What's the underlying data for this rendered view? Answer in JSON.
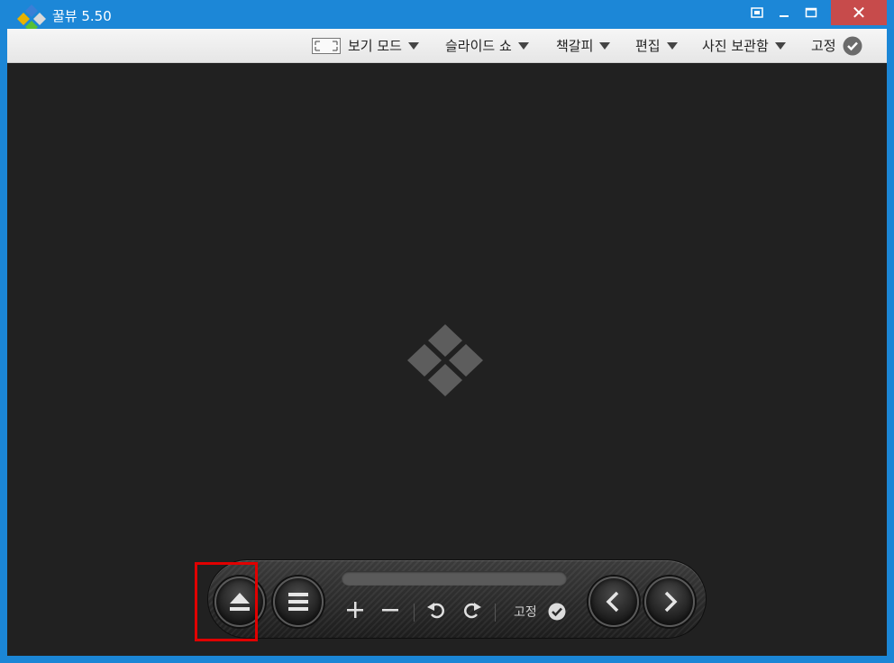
{
  "window": {
    "title": "꿀뷰 5.50",
    "close_symbol": "✕"
  },
  "menu": {
    "view_mode": "보기 모드",
    "slideshow": "슬라이드 쇼",
    "bookmark": "책갈피",
    "edit": "편집",
    "album": "사진 보관함",
    "pin": "고정"
  },
  "toolbar": {
    "pin_label": "고정",
    "progress": 0
  },
  "icons": {
    "app": "honeyview-diamond-logo",
    "view_mode": "fullscreen-frame-icon",
    "eject": "eject-icon",
    "menu": "hamburger-icon",
    "zoom_in": "plus-icon",
    "zoom_out": "minus-icon",
    "rotate_left": "rotate-left-icon",
    "rotate_right": "rotate-right-icon",
    "prev": "chevron-left-icon",
    "next": "chevron-right-icon",
    "check": "check-circle-icon"
  },
  "colors": {
    "titlebar": "#1c87d7",
    "close": "#c74b4b",
    "viewer_bg": "#212121",
    "highlight": "#e00000"
  }
}
